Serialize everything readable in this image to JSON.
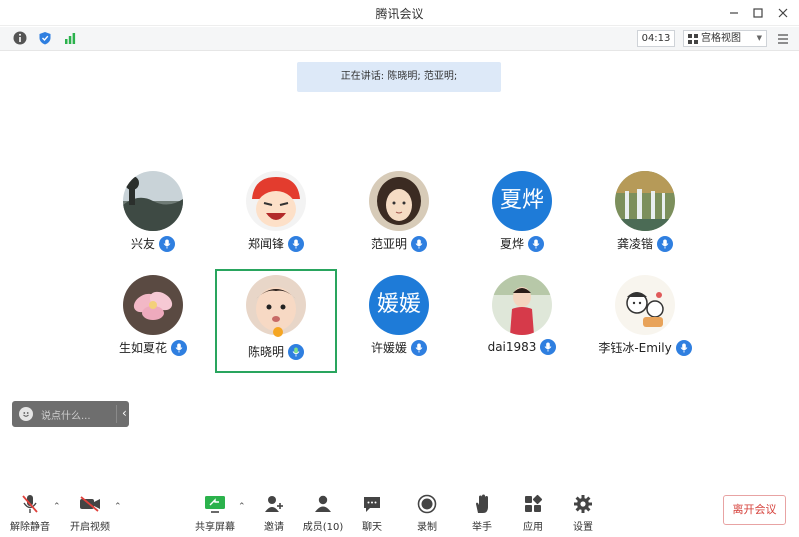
{
  "window": {
    "title": "腾讯会议"
  },
  "topbar": {
    "timer": "04:13",
    "view_label": "宫格视图"
  },
  "speaking": {
    "text": "正在讲话: 陈晓明; 范亚明;"
  },
  "participants": [
    {
      "name": "兴友",
      "avatar": "photo-landscape"
    },
    {
      "name": "郑闻锋",
      "avatar": "cartoon-laughing"
    },
    {
      "name": "范亚明",
      "avatar": "cartoon-girl"
    },
    {
      "name": "夏烨",
      "avatar_text": "夏烨"
    },
    {
      "name": "龚凌锴",
      "avatar": "photo-waterfall"
    },
    {
      "name": "生如夏花",
      "avatar": "photo-flower"
    },
    {
      "name": "陈晓明",
      "avatar": "photo-baby",
      "active": true
    },
    {
      "name": "许媛媛",
      "avatar_text": "媛媛"
    },
    {
      "name": "dai1983",
      "avatar": "photo-child"
    },
    {
      "name": "李钰冰-Emily",
      "avatar": "cartoon-sketch"
    }
  ],
  "chat": {
    "placeholder": "说点什么..."
  },
  "toolbar": {
    "unmute": "解除静音",
    "start_video": "开启视频",
    "share_screen": "共享屏幕",
    "invite": "邀请",
    "members": "成员(10)",
    "chat": "聊天",
    "record": "录制",
    "raise_hand": "举手",
    "apps": "应用",
    "settings": "设置",
    "leave": "离开会议"
  },
  "colors": {
    "accent": "#2f7fe0",
    "active_border": "#29a55e",
    "leave_text": "#d6403a",
    "banner": "#dde9f8"
  }
}
